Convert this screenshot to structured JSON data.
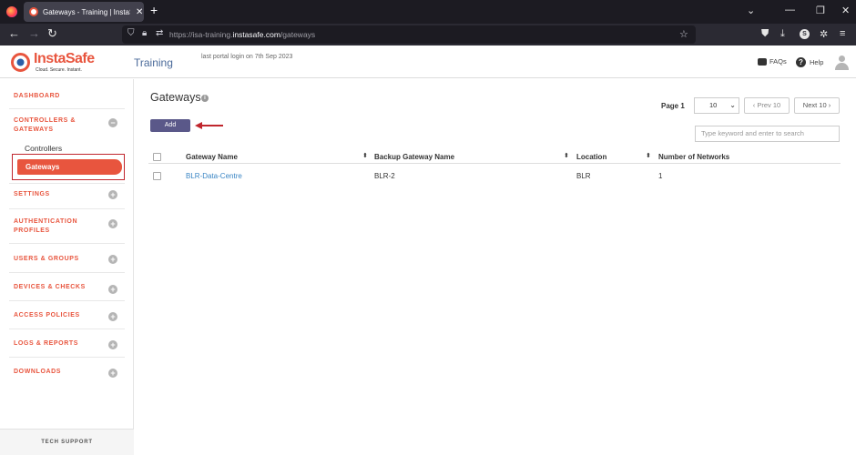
{
  "browser": {
    "tab_title": "Gateways - Training | InstaSafe",
    "url_prefix": "https://isa-training.",
    "url_domain": "instasafe.com",
    "url_path": "/gateways",
    "profile_initial": "S"
  },
  "header": {
    "logo_name": "InstaSafe",
    "logo_tagline": "Cloud. Secure. Instant.",
    "app_title": "Training",
    "last_login": "last portal login on 7th Sep 2023",
    "faqs_label": "FAQs",
    "help_label": "Help"
  },
  "sidebar": {
    "dashboard": "DASHBOARD",
    "controllers_gateways_line1": "CONTROLLERS &",
    "controllers_gateways_line2": "GATEWAYS",
    "sub_controllers": "Controllers",
    "sub_gateways": "Gateways",
    "settings": "SETTINGS",
    "auth_line1": "AUTHENTICATION",
    "auth_line2": "PROFILES",
    "users_groups": "USERS & GROUPS",
    "devices_checks": "DEVICES & CHECKS",
    "access_policies": "ACCESS POLICIES",
    "logs_reports": "LOGS & REPORTS",
    "downloads": "DOWNLOADS",
    "tech_support": "TECH SUPPORT"
  },
  "main": {
    "title": "Gateways",
    "add_label": "Add",
    "page_label": "Page 1",
    "page_size": "10",
    "prev_label": "‹ Prev 10",
    "next_label": "Next 10 ›",
    "search_placeholder": "Type keyword and enter to search",
    "columns": [
      "Gateway Name",
      "Backup Gateway Name",
      "Location",
      "Number of Networks"
    ],
    "rows": [
      [
        "BLR-Data-Centre",
        "BLR-2",
        "BLR",
        "1"
      ]
    ]
  },
  "colors": {
    "brand_orange": "#e8553e",
    "add_button": "#5a5889",
    "link_blue": "#3b86c5",
    "annotation_red": "#c0262d"
  },
  "icons": {
    "collapse": "minus-circle-icon",
    "expand": "plus-circle-icon",
    "info": "info-icon",
    "sort": "sort-icon"
  }
}
